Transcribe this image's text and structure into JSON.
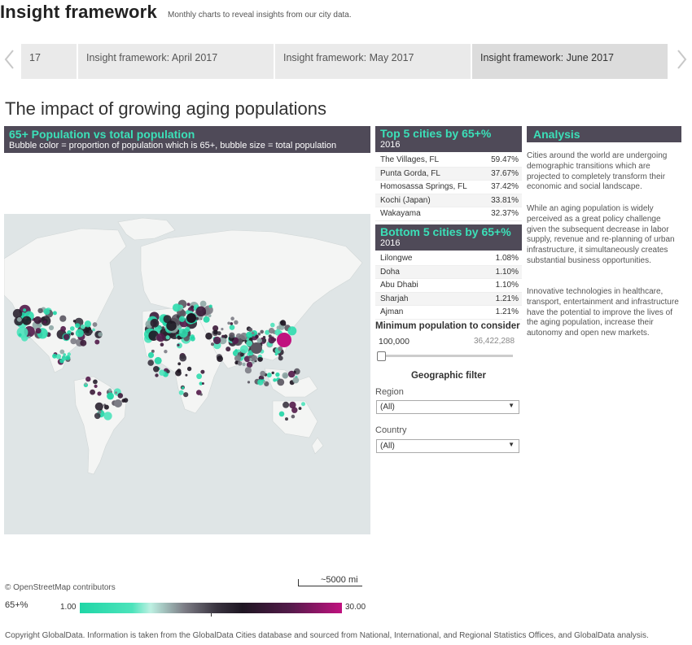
{
  "brand": {
    "title": "Insight framework",
    "subtitle": "Monthly charts to reveal insights from our city data."
  },
  "carousel": {
    "tabs": [
      {
        "label": "17"
      },
      {
        "label": "Insight framework: April 2017"
      },
      {
        "label": "Insight framework: May 2017"
      },
      {
        "label": "Insight framework: June 2017",
        "active": true
      }
    ]
  },
  "page": {
    "title": "The impact of growing aging populations"
  },
  "map": {
    "title": "65+ Population vs total population",
    "subtitle": "Bubble color = proportion of population which is 65+, bubble size = total population",
    "attribution": "© OpenStreetMap contributors",
    "scale_label": "~5000 mi",
    "legend": {
      "label": "65+%",
      "min": "1.00",
      "max": "30.00"
    }
  },
  "top5": {
    "title": "Top 5 cities by 65+%",
    "year": "2016",
    "rows": [
      {
        "city": "The Villages, FL",
        "value": "59.47%"
      },
      {
        "city": "Punta Gorda, FL",
        "value": "37.67%"
      },
      {
        "city": "Homosassa Springs, FL",
        "value": "37.42%"
      },
      {
        "city": "Kochi (Japan)",
        "value": "33.81%"
      },
      {
        "city": "Wakayama",
        "value": "32.37%"
      }
    ]
  },
  "bottom5": {
    "title": "Bottom 5 cities by 65+%",
    "year": "2016",
    "rows": [
      {
        "city": "Lilongwe",
        "value": "1.08%"
      },
      {
        "city": "Doha",
        "value": "1.10%"
      },
      {
        "city": "Abu Dhabi",
        "value": "1.10%"
      },
      {
        "city": "Sharjah",
        "value": "1.21%"
      },
      {
        "city": "Ajman",
        "value": "1.21%"
      }
    ]
  },
  "filters": {
    "min_pop_title": "Minimum population to consider",
    "min_pop_value": "100,000",
    "max_pop_value": "36,422,288",
    "slider_fraction": 0,
    "geo_title": "Geographic filter",
    "region_label": "Region",
    "region_value": "(All)",
    "country_label": "Country",
    "country_value": "(All)"
  },
  "analysis": {
    "title": "Analysis",
    "paragraphs": [
      "Cities around the world are undergoing demographic transitions which are projected to completely transform their economic and social landscape.",
      "While an aging population is widely perceived as a great policy challenge given the subsequent decrease in labor supply, revenue and re-planning of urban infrastructure, it simultaneously creates substantial business opportunities.",
      "Innovative technologies  in healthcare, transport, entertainment and infrastructure have the potential to improve the lives of the aging population, increase their autonomy and open new markets."
    ]
  },
  "footer": {
    "copyright": "Copyright GlobalData. Information is taken from the GlobalData Cities database and sourced from National, International, and Regional Statistics Offices, and GlobalData analysis."
  },
  "colors": {
    "header_bg": "#4f4a58",
    "accent": "#3be0b8",
    "high": "#c0117f",
    "low": "#1fd6a6"
  }
}
